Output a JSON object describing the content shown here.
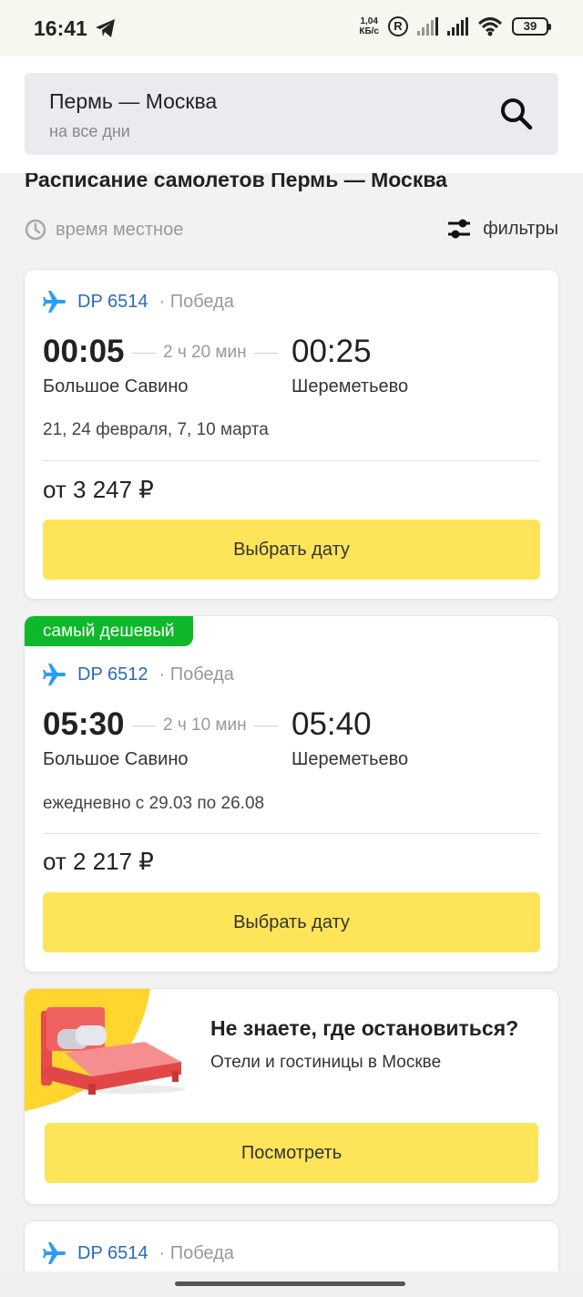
{
  "status_bar": {
    "time": "16:41",
    "speed_value": "1,04",
    "speed_unit": "КБ/с",
    "r_badge": "R",
    "battery": "39"
  },
  "search": {
    "route": "Пермь — Москва",
    "days": "на все дни"
  },
  "page": {
    "title": "Расписание самолетов Пермь — Москва",
    "timezone_label": "время местное",
    "filters_label": "фильтры"
  },
  "flights": [
    {
      "flight_no": "DP 6514",
      "airline": "Победа",
      "dep_time": "00:05",
      "duration": "2 ч 20 мин",
      "arr_time": "00:25",
      "dep_airport": "Большое Савино",
      "arr_airport": "Шереметьево",
      "dates": "21, 24 февраля, 7, 10 марта",
      "price": "от 3 247 ₽",
      "button": "Выбрать дату"
    },
    {
      "badge": "самый дешевый",
      "flight_no": "DP 6512",
      "airline": "Победа",
      "dep_time": "05:30",
      "duration": "2 ч 10 мин",
      "arr_time": "05:40",
      "dep_airport": "Большое Савино",
      "arr_airport": "Шереметьево",
      "dates": "ежедневно с 29.03 по 26.08",
      "price": "от 2 217 ₽",
      "button": "Выбрать дату"
    },
    {
      "flight_no": "DP 6514",
      "airline": "Победа"
    }
  ],
  "promo": {
    "title": "Не знаете, где остановиться?",
    "subtitle": "Отели и гостиницы в Москве",
    "button": "Посмотреть"
  },
  "colors": {
    "accent_yellow": "#fde459",
    "cheapest_green": "#0eb82a",
    "flight_blue": "#2a6bb5",
    "promo_yellow": "#ffd52e"
  }
}
